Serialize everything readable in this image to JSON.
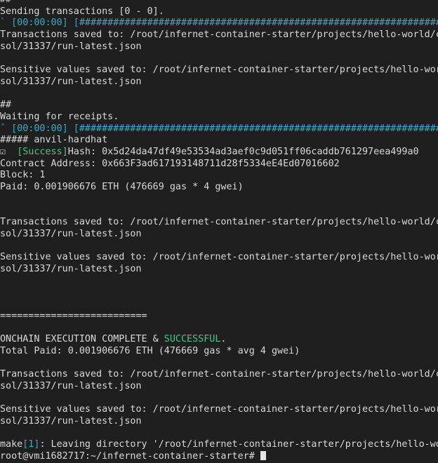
{
  "colors": {
    "background": "#1f1f1f",
    "text": "#d9d9d9",
    "cyan": "#3aa8c8",
    "green": "#3fc98a"
  },
  "lines": [
    {
      "type": "text",
      "text": "##"
    },
    {
      "type": "text",
      "text": "Sending transactions [0 - 0]."
    },
    {
      "type": "progress",
      "prefix": "` ",
      "time": "[00:00:00]",
      "bar": " [########################################################################]"
    },
    {
      "type": "text",
      "text": "Transactions saved to: /root/infernet-container-starter/projects/hello-world/contracts/broadcast/Deploy.s."
    },
    {
      "type": "text",
      "text": "sol/31337/run-latest.json"
    },
    {
      "type": "blank"
    },
    {
      "type": "text",
      "text": "Sensitive values saved to: /root/infernet-container-starter/projects/hello-world/contracts/cache/Deploy.s."
    },
    {
      "type": "text",
      "text": "sol/31337/run-latest.json"
    },
    {
      "type": "blank"
    },
    {
      "type": "text",
      "text": "##"
    },
    {
      "type": "text",
      "text": "Waiting for receipts."
    },
    {
      "type": "progress",
      "prefix": "ˆ ",
      "time": "[00:00:00]",
      "bar": " [########################################################################]"
    },
    {
      "type": "text",
      "text": "##### anvil-hardhat"
    },
    {
      "type": "success",
      "prefix": "☑  ",
      "label": "[Success]",
      "rest": "Hash: 0x5d24da47df49e53534ad3aef0c9d051ff06caddb761297eea499a0"
    },
    {
      "type": "text",
      "text": "Contract Address: 0x663F3ad617193148711d28f5334eE4Ed07016602"
    },
    {
      "type": "text",
      "text": "Block: 1"
    },
    {
      "type": "text",
      "text": "Paid: 0.001906676 ETH (476669 gas * 4 gwei)"
    },
    {
      "type": "blank"
    },
    {
      "type": "blank"
    },
    {
      "type": "text",
      "text": "Transactions saved to: /root/infernet-container-starter/projects/hello-world/contracts/broadcast/Deploy.s."
    },
    {
      "type": "text",
      "text": "sol/31337/run-latest.json"
    },
    {
      "type": "blank"
    },
    {
      "type": "text",
      "text": "Sensitive values saved to: /root/infernet-container-starter/projects/hello-world/contracts/cache/Deploy.s."
    },
    {
      "type": "text",
      "text": "sol/31337/run-latest.json"
    },
    {
      "type": "blank"
    },
    {
      "type": "blank"
    },
    {
      "type": "blank"
    },
    {
      "type": "text",
      "text": "=========================="
    },
    {
      "type": "blank"
    },
    {
      "type": "complete",
      "before": "ONCHAIN EXECUTION COMPLETE & ",
      "highlight": "SUCCESSFUL",
      "after": "."
    },
    {
      "type": "text",
      "text": "Total Paid: 0.001906676 ETH (476669 gas * avg 4 gwei)"
    },
    {
      "type": "blank"
    },
    {
      "type": "text",
      "text": "Transactions saved to: /root/infernet-container-starter/projects/hello-world/contracts/broadcast/Deploy.s."
    },
    {
      "type": "text",
      "text": "sol/31337/run-latest.json"
    },
    {
      "type": "blank"
    },
    {
      "type": "text",
      "text": "Sensitive values saved to: /root/infernet-container-starter/projects/hello-world/contracts/cache/Deploy.s."
    },
    {
      "type": "text",
      "text": "sol/31337/run-latest.json"
    },
    {
      "type": "blank"
    },
    {
      "type": "make",
      "before": "make",
      "bracket": "[1]",
      "after": ": Leaving directory '/root/infernet-container-starter/projects/hello-world/contracts'"
    },
    {
      "type": "prompt",
      "text": "root@vmi1682717:~/infernet-container-starter# "
    }
  ]
}
